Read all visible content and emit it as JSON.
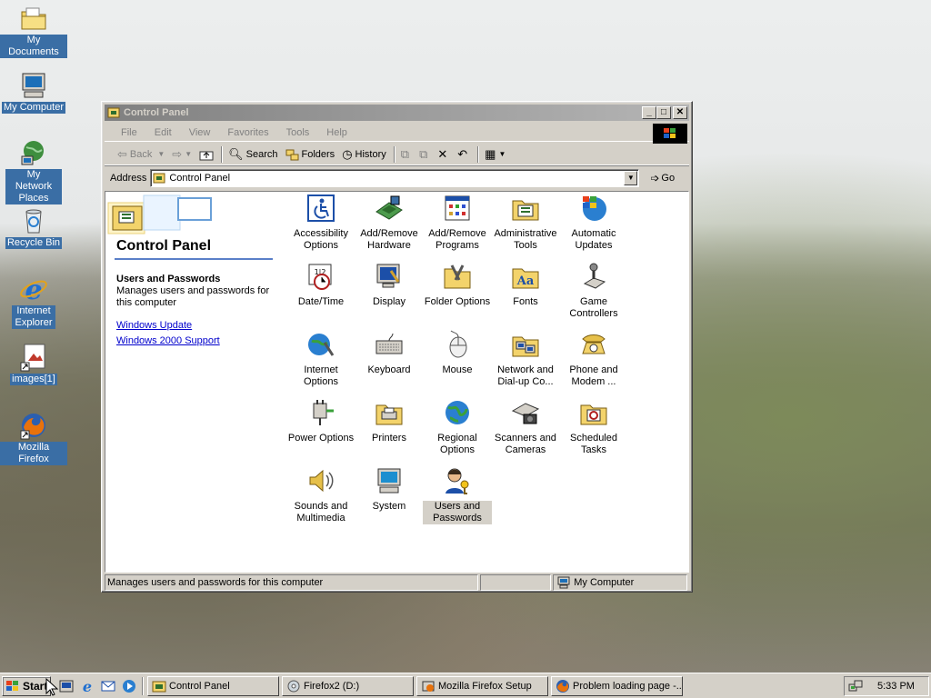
{
  "desktop": {
    "icons": [
      {
        "label": "My Documents",
        "icon": "folder-documents-icon"
      },
      {
        "label": "My Computer",
        "icon": "computer-icon"
      },
      {
        "label": "My Network Places",
        "icon": "network-places-icon"
      },
      {
        "label": "Recycle Bin",
        "icon": "recycle-bin-icon"
      },
      {
        "label": "Internet Explorer",
        "icon": "internet-explorer-icon"
      },
      {
        "label": "images[1]",
        "icon": "image-file-icon"
      },
      {
        "label": "Mozilla Firefox",
        "icon": "firefox-icon"
      }
    ]
  },
  "window": {
    "title": "Control Panel",
    "menu": [
      "File",
      "Edit",
      "View",
      "Favorites",
      "Tools",
      "Help"
    ],
    "toolbar": {
      "back": "Back",
      "search": "Search",
      "folders": "Folders",
      "history": "History"
    },
    "address": {
      "label": "Address",
      "value": "Control Panel",
      "go": "Go"
    },
    "left_pane": {
      "title": "Control Panel",
      "selected_title": "Users and Passwords",
      "selected_desc": "Manages users and passwords for this computer",
      "links": [
        "Windows Update",
        "Windows 2000 Support"
      ]
    },
    "items": [
      "Accessibility Options",
      "Add/Remove Hardware",
      "Add/Remove Programs",
      "Administrative Tools",
      "Automatic Updates",
      "Date/Time",
      "Display",
      "Folder Options",
      "Fonts",
      "Game Controllers",
      "Internet Options",
      "Keyboard",
      "Mouse",
      "Network and Dial-up Co...",
      "Phone and Modem ...",
      "Power Options",
      "Printers",
      "Regional Options",
      "Scanners and Cameras",
      "Scheduled Tasks",
      "Sounds and Multimedia",
      "System",
      "Users and Passwords"
    ],
    "selected_item": "Users and Passwords",
    "status": {
      "text": "Manages users and passwords for this computer",
      "zone": "My Computer"
    }
  },
  "taskbar": {
    "start": "Start",
    "tasks": [
      {
        "label": "Control Panel",
        "icon": "control-panel-icon"
      },
      {
        "label": "Firefox2 (D:)",
        "icon": "cd-drive-icon"
      },
      {
        "label": "Mozilla Firefox Setup",
        "icon": "setup-icon"
      },
      {
        "label": "Problem loading page -...",
        "icon": "firefox-icon"
      }
    ],
    "clock": "5:33 PM"
  },
  "colors": {
    "desktop_label_bg": "#3a6ea5",
    "window_face": "#d4d0c8",
    "inactive_title_start": "#808080",
    "inactive_title_end": "#b5b5b5",
    "link": "#0000cc",
    "accent_rule": "#5a7fc8"
  }
}
